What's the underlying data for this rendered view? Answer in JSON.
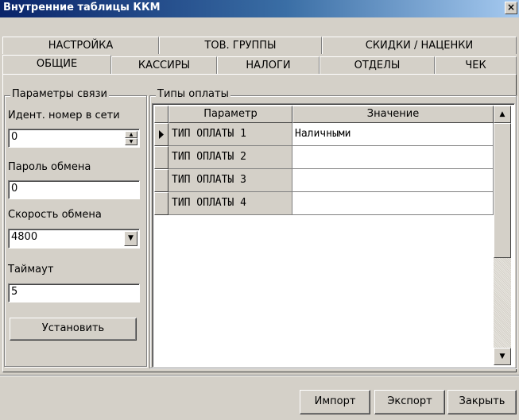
{
  "window": {
    "title": "Внутренние таблицы ККМ",
    "close_label": "×"
  },
  "tabs_row1": [
    {
      "label": "НАСТРОЙКА"
    },
    {
      "label": "ТОВ. ГРУППЫ"
    },
    {
      "label": "СКИДКИ / НАЦЕНКИ"
    }
  ],
  "tabs_row2": [
    {
      "label": "ОБЩИЕ",
      "active": true
    },
    {
      "label": "КАССИРЫ"
    },
    {
      "label": "НАЛОГИ"
    },
    {
      "label": "ОТДЕЛЫ"
    },
    {
      "label": "ЧЕК"
    }
  ],
  "connection": {
    "group_title": "Параметры связи",
    "net_id_label": "Идент. номер в сети",
    "net_id_value": "0",
    "password_label": "Пароль обмена",
    "password_value": "0",
    "speed_label": "Скорость обмена",
    "speed_value": "4800",
    "timeout_label": "Таймаут",
    "timeout_value": "5",
    "set_button": "Установить"
  },
  "payment_types": {
    "group_title": "Типы оплаты",
    "columns": [
      "Параметр",
      "Значение"
    ],
    "rows": [
      {
        "param": "ТИП ОПЛАТЫ 1",
        "value": "Наличными",
        "selected": true
      },
      {
        "param": "ТИП ОПЛАТЫ 2",
        "value": ""
      },
      {
        "param": "ТИП ОПЛАТЫ 3",
        "value": ""
      },
      {
        "param": "ТИП ОПЛАТЫ 4",
        "value": ""
      }
    ]
  },
  "footer": {
    "import_button": "Импорт",
    "export_button": "Экспорт",
    "close_button": "Закрыть"
  },
  "colors": {
    "face": "#d4d0c8",
    "title_start": "#0a246a",
    "title_end": "#a6caf0"
  },
  "icons": {
    "close": "close-icon",
    "spin_up": "spin-up-icon",
    "spin_down": "spin-down-icon",
    "combo": "chevron-down-icon",
    "row_pointer": "row-pointer-icon",
    "scroll_up": "scroll-up-icon",
    "scroll_down": "scroll-down-icon"
  }
}
